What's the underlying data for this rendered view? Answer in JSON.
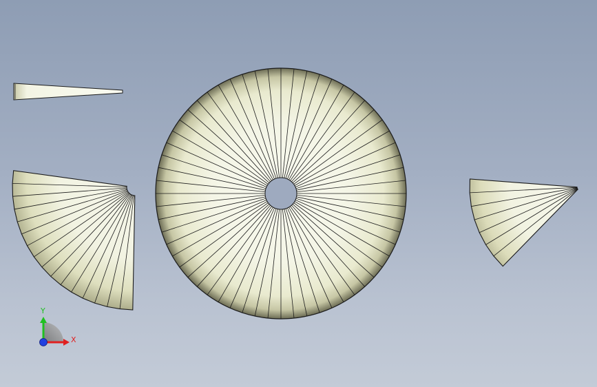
{
  "viewport": {
    "background_top": "#8e9db4",
    "background_bottom": "#c3cbd7"
  },
  "model": {
    "face_color": "#f6f7ea",
    "shade_color": "#c9c9a8",
    "edge_color": "#1a1a1a",
    "full_disc_segments": 60,
    "sector_left_segments": 16,
    "sector_right_segments": 7
  },
  "triad": {
    "x_label": "X",
    "y_label": "Y",
    "x_color": "#e02020",
    "y_color": "#20c020",
    "z_color": "#2040e0"
  }
}
